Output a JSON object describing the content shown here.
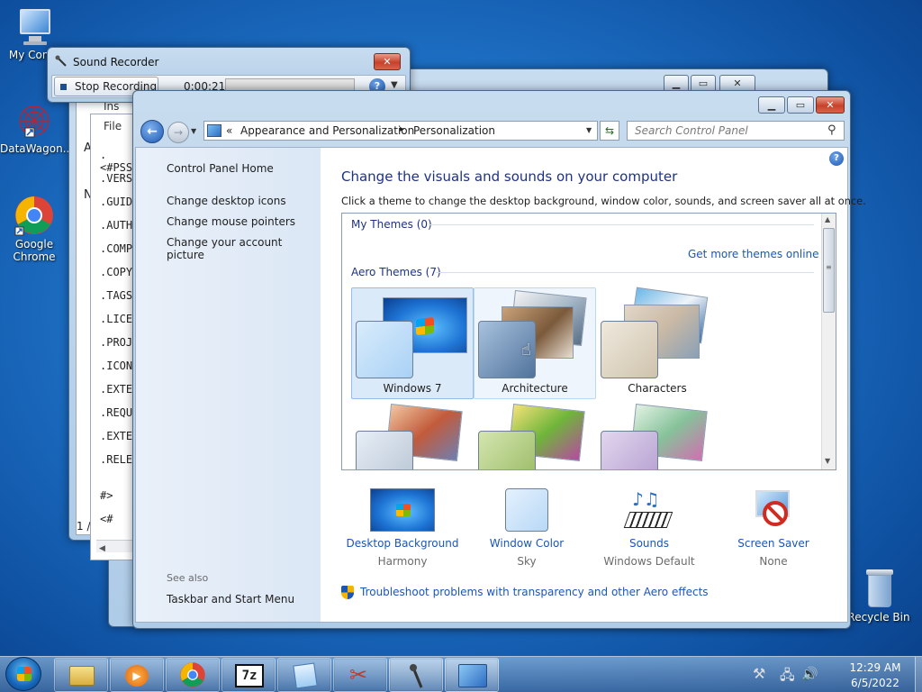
{
  "desktop": {
    "icons": [
      {
        "label": "My Comp",
        "icon": "computer-icon"
      },
      {
        "label": "DataWagon...",
        "icon": "datawagon-icon"
      },
      {
        "label": "Google\nChrome",
        "label_line1": "Google",
        "label_line2": "Chrome",
        "icon": "chrome-icon"
      },
      {
        "label": "Recycle Bin",
        "icon": "recycle-bin-icon"
      }
    ]
  },
  "sound_recorder": {
    "title": "Sound Recorder",
    "stop_button_label": "Stop Recording",
    "elapsed": "0:00:21"
  },
  "editor_window": {
    "title": "Ins",
    "menu_file": "File",
    "side_letters": [
      "A",
      "N"
    ],
    "code_lines": [
      ".<#PSS",
      ".VERS",
      ".GUID",
      ".AUTH",
      ".COMP",
      ".COPY",
      ".TAGS",
      ".LICE",
      ".PROJ",
      ".ICON",
      ".EXTE",
      ".REQU",
      ".EXTE",
      ".RELE",
      "#>",
      "<#"
    ],
    "status": "1 /"
  },
  "control_panel": {
    "breadcrumb": {
      "prefix": "«",
      "part1": "Appearance and Personalization",
      "sep": "▸",
      "part2": "Personalization"
    },
    "search_placeholder": "Search Control Panel",
    "left_nav": {
      "home": "Control Panel Home",
      "items": [
        "Change desktop icons",
        "Change mouse pointers",
        "Change your account picture"
      ],
      "see_also": "See also",
      "see_also_items": [
        "Taskbar and Start Menu"
      ]
    },
    "heading": "Change the visuals and sounds on your computer",
    "subheading": "Click a theme to change the desktop background, window color, sounds, and screen saver all at once.",
    "themes": {
      "my_themes_label": "My Themes (0)",
      "get_more": "Get more themes online",
      "aero_label": "Aero Themes (7)",
      "items": [
        "Windows 7",
        "Architecture",
        "Characters"
      ]
    },
    "bottom": [
      {
        "name": "Desktop Background",
        "value": "Harmony",
        "icon": "desktop-background-icon"
      },
      {
        "name": "Window Color",
        "value": "Sky",
        "icon": "window-color-icon"
      },
      {
        "name": "Sounds",
        "value": "Windows Default",
        "icon": "sounds-icon"
      },
      {
        "name": "Screen Saver",
        "value": "None",
        "icon": "screen-saver-icon"
      }
    ],
    "troubleshoot": "Troubleshoot problems with transparency and other Aero effects"
  },
  "taskbar": {
    "time": "12:29 AM",
    "date": "6/5/2022"
  },
  "colors": {
    "link": "#1a56b8",
    "nav_bg": "#dbe7f5",
    "accent": "#1d6fc4"
  }
}
